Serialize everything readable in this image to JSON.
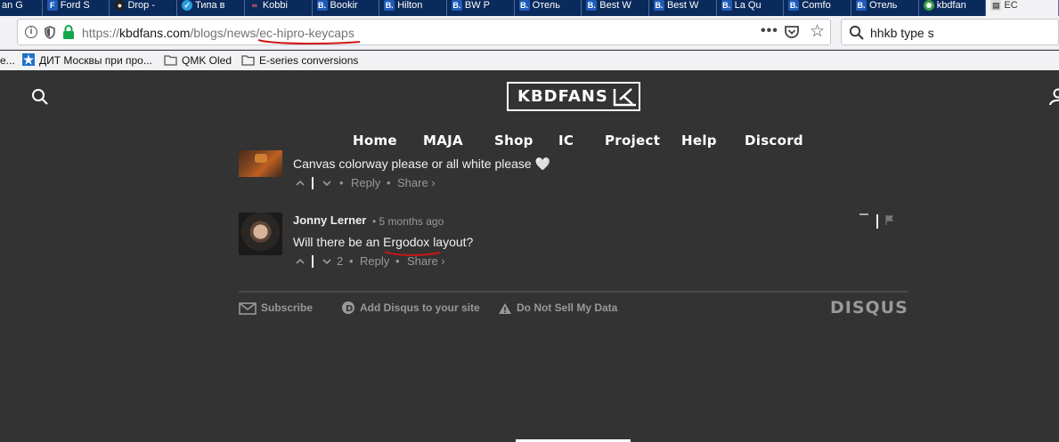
{
  "browser": {
    "tabs": [
      {
        "title": "an G",
        "fav": "doc",
        "glyph": ""
      },
      {
        "title": "Ford S",
        "fav": "b",
        "glyph": "F"
      },
      {
        "title": "Drop -",
        "fav": "gh",
        "glyph": "●"
      },
      {
        "title": "Типа в",
        "fav": "tg",
        "glyph": "✓"
      },
      {
        "title": "Kobbi",
        "fav": "ab",
        "glyph": "∞"
      },
      {
        "title": "Bookir",
        "fav": "b",
        "glyph": "B."
      },
      {
        "title": "Hilton",
        "fav": "b",
        "glyph": "B."
      },
      {
        "title": "BW P",
        "fav": "b",
        "glyph": "B."
      },
      {
        "title": "Отель",
        "fav": "b",
        "glyph": "B."
      },
      {
        "title": "Best W",
        "fav": "b",
        "glyph": "B."
      },
      {
        "title": "Best W",
        "fav": "b",
        "glyph": "B."
      },
      {
        "title": "La Qu",
        "fav": "b",
        "glyph": "B."
      },
      {
        "title": "Comfo",
        "fav": "b",
        "glyph": "B."
      },
      {
        "title": "Отель",
        "fav": "b",
        "glyph": "B."
      },
      {
        "title": "kbdfan",
        "fav": "ch",
        "glyph": ""
      },
      {
        "title": "EC",
        "fav": "doc",
        "glyph": "▤"
      }
    ],
    "url": {
      "scheme": "https://",
      "domain": "kbdfans.com",
      "path": "/blogs/news/ec-hipro-keycaps"
    },
    "more_label": "•••",
    "search_value": "hhkb type s",
    "bookmarks": [
      {
        "label": "e...",
        "icon": "none"
      },
      {
        "label": "ДИТ Москвы при про...",
        "icon": "star-logo-icon"
      },
      {
        "label": "QMK Oled",
        "icon": "folder-icon"
      },
      {
        "label": "E-series conversions",
        "icon": "folder-icon"
      }
    ]
  },
  "site": {
    "logo_text": "KBDFANS",
    "menu": [
      "Home",
      "MAJA",
      "Shop",
      "IC",
      "Project",
      "Help",
      "Discord"
    ]
  },
  "comments": {
    "first": {
      "text": "Canvas colorway please or all white please 🤍",
      "reply": "Reply",
      "share": "Share ›"
    },
    "second": {
      "author": "Jonny Lerner",
      "time": "• 5 months ago",
      "text": "Will there be an Ergodox layout?",
      "votes": "2",
      "reply": "Reply",
      "share": "Share ›",
      "bullet": "•"
    }
  },
  "footer": {
    "subscribe": "Subscribe",
    "add_disqus": "Add Disqus to your site",
    "do_not_sell": "Do Not Sell My Data",
    "brand": "DISQUS"
  },
  "colors": {
    "page_bg": "#333333",
    "tab_strip": "#0b2a5c",
    "annotation_red": "#d01414"
  }
}
